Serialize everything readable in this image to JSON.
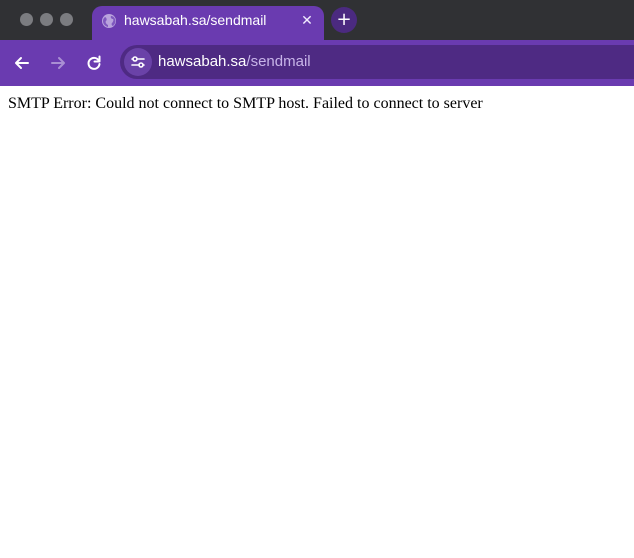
{
  "window": {
    "tab": {
      "title": "hawsabah.sa/sendmail",
      "favicon": "globe-icon",
      "close_icon": "close-icon"
    },
    "new_tab_icon": "plus-icon"
  },
  "toolbar": {
    "back_icon": "arrow-left-icon",
    "forward_icon": "arrow-right-icon",
    "reload_icon": "reload-icon",
    "site_info_icon": "tune-icon",
    "url_host": "hawsabah.sa",
    "url_path": "/sendmail"
  },
  "page": {
    "message": "SMTP Error: Could not connect to SMTP host. Failed to connect to server"
  },
  "colors": {
    "accent": "#6a3bb0",
    "omnibox": "#4e2a83",
    "tabstrip": "#303134"
  }
}
